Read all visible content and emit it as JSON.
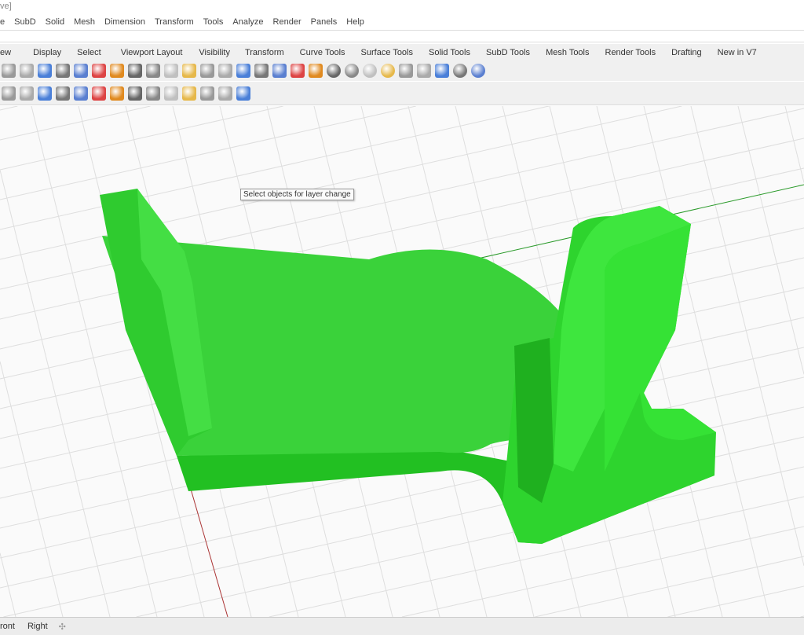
{
  "window": {
    "title_fragment": "ve]"
  },
  "menu": [
    "e",
    "SubD",
    "Solid",
    "Mesh",
    "Dimension",
    "Transform",
    "Tools",
    "Analyze",
    "Render",
    "Panels",
    "Help"
  ],
  "tabs": [
    "ew",
    "Display",
    "Select",
    "Viewport Layout",
    "Visibility",
    "Transform",
    "Curve Tools",
    "Surface Tools",
    "Solid Tools",
    "SubD Tools",
    "Mesh Tools",
    "Render Tools",
    "Drafting",
    "New in V7"
  ],
  "toolbar1_icons": [
    "new-icon",
    "paste-icon",
    "undo-icon",
    "pan-icon",
    "rotate-view-icon",
    "zoom-icon",
    "zoom-window-icon",
    "zoom-extents-icon",
    "zoom-selected-icon",
    "undo-view-icon",
    "four-viewports-icon",
    "car-icon",
    "cplane-icon",
    "distance-icon",
    "grid-snap-icon",
    "light-icon",
    "lock-icon",
    "layer-icon",
    "color-wheel-icon",
    "shaded-sphere-icon",
    "rendered-sphere-icon",
    "material-sphere-icon",
    "cone-icon",
    "gear-icon",
    "points-icon",
    "globe-icon",
    "help-icon"
  ],
  "toolbar2_icons": [
    "arc-icon",
    "polyline-icon",
    "array-icon",
    "surface-icon",
    "boolean-icon",
    "bulb-icon",
    "box-icon",
    "explode-icon",
    "gumball-icon",
    "solid-box-icon",
    "box-edit-icon",
    "curve-icon",
    "group-icon",
    "cylinder-icon"
  ],
  "tooltip": "Select objects for layer change",
  "viewport_tabs": [
    "ront",
    "Right"
  ],
  "add_tab_icon": "plus-icon",
  "colors": {
    "model": "#2fd62f",
    "grid": "#dcdcdc"
  }
}
